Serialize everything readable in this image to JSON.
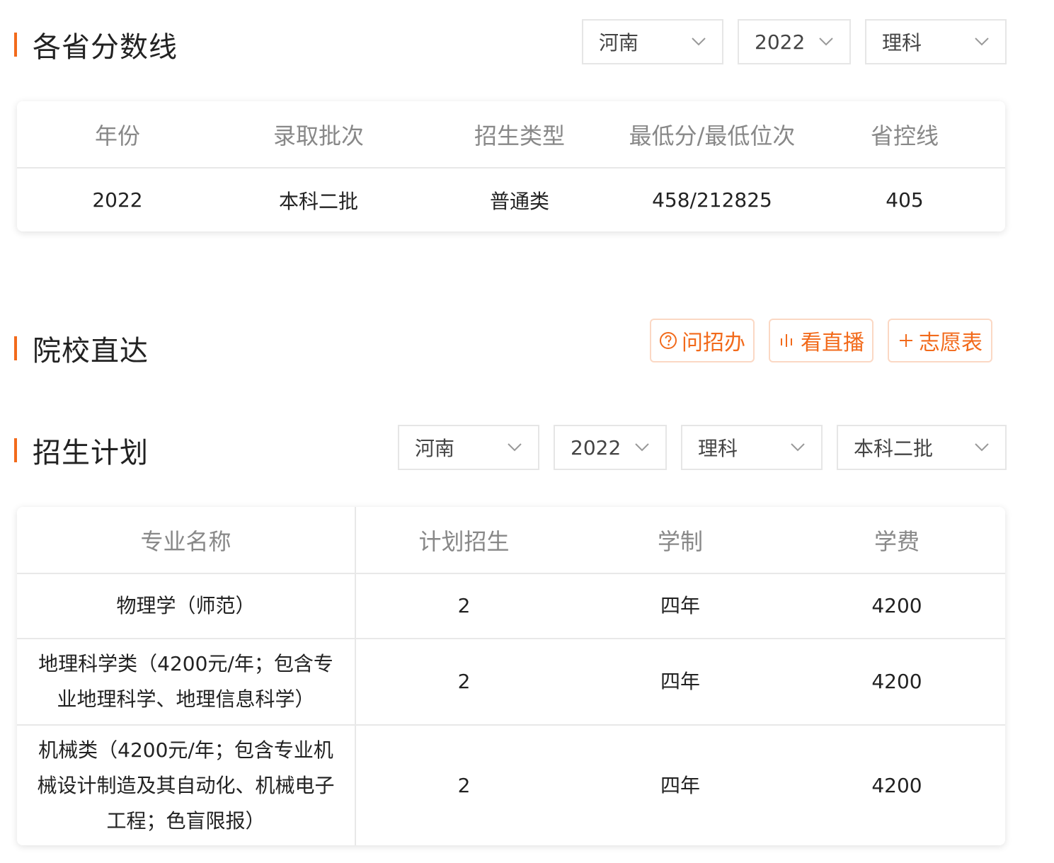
{
  "scores": {
    "title": "各省分数线",
    "filters": {
      "province": "河南",
      "year": "2022",
      "subject": "理科"
    },
    "headers": [
      "年份",
      "录取批次",
      "招生类型",
      "最低分/最低位次",
      "省控线"
    ],
    "rows": [
      [
        "2022",
        "本科二批",
        "普通类",
        "458/212825",
        "405"
      ]
    ]
  },
  "direct": {
    "title": "院校直达",
    "buttons": {
      "ask": "问招办",
      "live": "看直播",
      "wish": "志愿表"
    }
  },
  "plan": {
    "title": "招生计划",
    "filters": {
      "province": "河南",
      "year": "2022",
      "subject": "理科",
      "batch": "本科二批"
    },
    "headers": [
      "专业名称",
      "计划招生",
      "学制",
      "学费"
    ],
    "rows": [
      [
        "物理学（师范）",
        "2",
        "四年",
        "4200"
      ],
      [
        "地理科学类（4200元/年；包含专业地理科学、地理信息科学）",
        "2",
        "四年",
        "4200"
      ],
      [
        "机械类（4200元/年；包含专业机械设计制造及其自动化、机械电子工程；色盲限报）",
        "2",
        "四年",
        "4200"
      ]
    ]
  },
  "colors": {
    "accent": "#f26a1b",
    "border": "#e6e6e6",
    "header_text": "#888888"
  }
}
